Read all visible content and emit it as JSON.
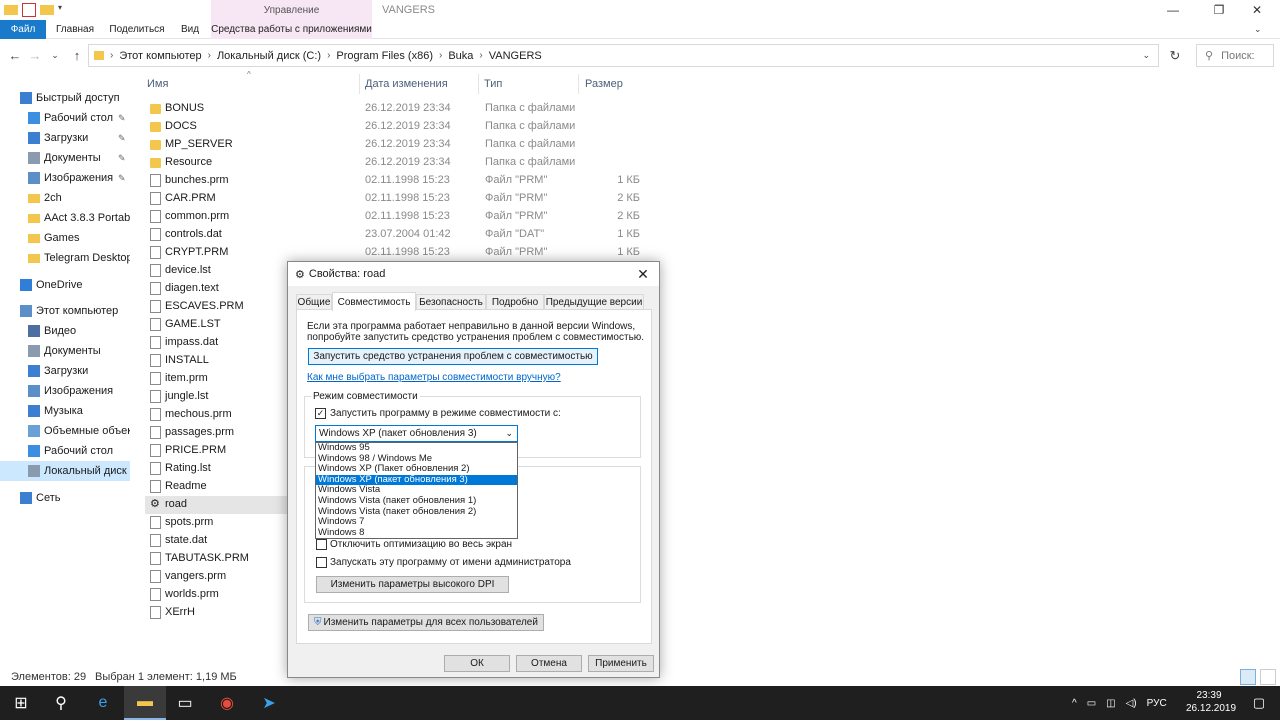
{
  "window": {
    "title": "VANGERS",
    "context_tab_header": "Управление",
    "minimize_icon": "minimize-icon",
    "maximize_icon": "maximize-icon",
    "close_icon": "close-icon"
  },
  "ribbon": {
    "tabs": [
      "Файл",
      "Главная",
      "Поделиться",
      "Вид",
      "Средства работы с приложениями"
    ]
  },
  "address": {
    "crumbs": [
      "Этот компьютер",
      "Локальный диск (C:)",
      "Program Files (x86)",
      "Buka",
      "VANGERS"
    ],
    "search_placeholder": "Поиск:"
  },
  "sidebar": {
    "items": [
      {
        "label": "Быстрый доступ",
        "icon": "star-icon",
        "pinned": false
      },
      {
        "label": "Рабочий стол",
        "icon": "desktop-icon",
        "pinned": true
      },
      {
        "label": "Загрузки",
        "icon": "download-icon",
        "pinned": true
      },
      {
        "label": "Документы",
        "icon": "documents-icon",
        "pinned": true
      },
      {
        "label": "Изображения",
        "icon": "pictures-icon",
        "pinned": true
      },
      {
        "label": "2ch",
        "icon": "folder-icon",
        "pinned": false
      },
      {
        "label": "AAct 3.8.3 Portable",
        "icon": "folder-icon",
        "pinned": false
      },
      {
        "label": "Games",
        "icon": "folder-icon",
        "pinned": false
      },
      {
        "label": "Telegram Desktop",
        "icon": "folder-icon",
        "pinned": false
      },
      {
        "label": "OneDrive",
        "icon": "cloud-icon",
        "pinned": false
      },
      {
        "label": "Этот компьютер",
        "icon": "computer-icon",
        "pinned": false
      },
      {
        "label": "Видео",
        "icon": "video-icon",
        "pinned": false
      },
      {
        "label": "Документы",
        "icon": "documents-icon",
        "pinned": false
      },
      {
        "label": "Загрузки",
        "icon": "download-icon",
        "pinned": false
      },
      {
        "label": "Изображения",
        "icon": "pictures-icon",
        "pinned": false
      },
      {
        "label": "Музыка",
        "icon": "music-icon",
        "pinned": false
      },
      {
        "label": "Объемные объекты",
        "icon": "3d-objects-icon",
        "pinned": false
      },
      {
        "label": "Рабочий стол",
        "icon": "desktop-icon",
        "pinned": false
      },
      {
        "label": "Локальный диск (C:)",
        "icon": "drive-icon",
        "pinned": false
      },
      {
        "label": "Сеть",
        "icon": "network-icon",
        "pinned": false
      }
    ]
  },
  "filelist": {
    "columns": [
      "Имя",
      "Дата изменения",
      "Тип",
      "Размер"
    ],
    "rows": [
      {
        "name": "BONUS",
        "date": "26.12.2019 23:34",
        "type": "Папка с файлами",
        "size": "",
        "kind": "folder"
      },
      {
        "name": "DOCS",
        "date": "26.12.2019 23:34",
        "type": "Папка с файлами",
        "size": "",
        "kind": "folder"
      },
      {
        "name": "MP_SERVER",
        "date": "26.12.2019 23:34",
        "type": "Папка с файлами",
        "size": "",
        "kind": "folder"
      },
      {
        "name": "Resource",
        "date": "26.12.2019 23:34",
        "type": "Папка с файлами",
        "size": "",
        "kind": "folder"
      },
      {
        "name": "bunches.prm",
        "date": "02.11.1998 15:23",
        "type": "Файл \"PRM\"",
        "size": "1 КБ",
        "kind": "file"
      },
      {
        "name": "CAR.PRM",
        "date": "02.11.1998 15:23",
        "type": "Файл \"PRM\"",
        "size": "2 КБ",
        "kind": "file"
      },
      {
        "name": "common.prm",
        "date": "02.11.1998 15:23",
        "type": "Файл \"PRM\"",
        "size": "2 КБ",
        "kind": "file"
      },
      {
        "name": "controls.dat",
        "date": "23.07.2004 01:42",
        "type": "Файл \"DAT\"",
        "size": "1 КБ",
        "kind": "file"
      },
      {
        "name": "CRYPT.PRM",
        "date": "02.11.1998 15:23",
        "type": "Файл \"PRM\"",
        "size": "1 КБ",
        "kind": "file"
      },
      {
        "name": "device.lst",
        "date": "",
        "type": "",
        "size": "",
        "kind": "file"
      },
      {
        "name": "diagen.text",
        "date": "",
        "type": "",
        "size": "",
        "kind": "file"
      },
      {
        "name": "ESCAVES.PRM",
        "date": "",
        "type": "",
        "size": "",
        "kind": "file"
      },
      {
        "name": "GAME.LST",
        "date": "",
        "type": "",
        "size": "",
        "kind": "file"
      },
      {
        "name": "impass.dat",
        "date": "",
        "type": "",
        "size": "",
        "kind": "file"
      },
      {
        "name": "INSTALL",
        "date": "",
        "type": "",
        "size": "",
        "kind": "file"
      },
      {
        "name": "item.prm",
        "date": "",
        "type": "",
        "size": "",
        "kind": "file"
      },
      {
        "name": "jungle.lst",
        "date": "",
        "type": "",
        "size": "",
        "kind": "file"
      },
      {
        "name": "mechous.prm",
        "date": "",
        "type": "",
        "size": "",
        "kind": "file"
      },
      {
        "name": "passages.prm",
        "date": "",
        "type": "",
        "size": "",
        "kind": "file"
      },
      {
        "name": "PRICE.PRM",
        "date": "",
        "type": "",
        "size": "",
        "kind": "file"
      },
      {
        "name": "Rating.lst",
        "date": "",
        "type": "",
        "size": "",
        "kind": "file"
      },
      {
        "name": "Readme",
        "date": "",
        "type": "",
        "size": "",
        "kind": "file"
      },
      {
        "name": "road",
        "date": "",
        "type": "",
        "size": "",
        "kind": "exe",
        "selected": true
      },
      {
        "name": "spots.prm",
        "date": "",
        "type": "",
        "size": "",
        "kind": "file"
      },
      {
        "name": "state.dat",
        "date": "",
        "type": "",
        "size": "",
        "kind": "file"
      },
      {
        "name": "TABUTASK.PRM",
        "date": "",
        "type": "",
        "size": "",
        "kind": "file"
      },
      {
        "name": "vangers.prm",
        "date": "",
        "type": "",
        "size": "",
        "kind": "file"
      },
      {
        "name": "worlds.prm",
        "date": "",
        "type": "",
        "size": "",
        "kind": "file"
      },
      {
        "name": "XErrH",
        "date": "",
        "type": "",
        "size": "",
        "kind": "file"
      }
    ]
  },
  "status": {
    "count": "Элементов: 29",
    "selection": "Выбран 1 элемент: 1,19 МБ"
  },
  "dialog": {
    "title": "Свойства: road",
    "tabs": [
      "Общие",
      "Совместимость",
      "Безопасность",
      "Подробно",
      "Предыдущие версии"
    ],
    "intro_line1": "Если эта программа работает неправильно в данной версии Windows,",
    "intro_line2": "попробуйте запустить средство устранения проблем с совместимостью.",
    "troubleshoot_button": "Запустить средство устранения проблем с совместимостью",
    "manual_link": "Как мне выбрать параметры совместимости вручную?",
    "compat_group": "Режим совместимости",
    "compat_checkbox": "Запустить программу в режиме совместимости с:",
    "compat_selected": "Windows XP (пакет обновления 3)",
    "compat_options": [
      "Windows 95",
      "Windows 98 / Windows Me",
      "Windows XP (Пакет обновления 2)",
      "Windows XP (пакет обновления 3)",
      "Windows Vista",
      "Windows Vista (пакет обновления 1)",
      "Windows Vista (пакет обновления 2)",
      "Windows 7",
      "Windows 8"
    ],
    "fullscreen_opt": "Отключить оптимизацию во весь экран",
    "admin_opt": "Запускать эту программу от имени администратора",
    "dpi_button": "Изменить параметры высокого DPI",
    "all_users_button": "Изменить параметры для всех пользователей",
    "ok": "ОК",
    "cancel": "Отмена",
    "apply": "Применить"
  },
  "taskbar": {
    "lang": "РУС",
    "time": "23:39",
    "date": "26.12.2019"
  }
}
